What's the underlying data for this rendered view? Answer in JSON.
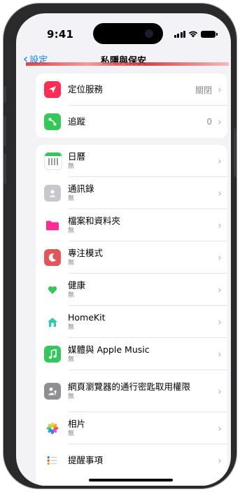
{
  "status": {
    "time": "9:41"
  },
  "nav": {
    "back_label": "設定",
    "title": "私隱與保安"
  },
  "group1": [
    {
      "label": "定位服務",
      "value": "關閉",
      "icon": "location-arrow-icon",
      "color": "#ff2d55"
    },
    {
      "label": "追蹤",
      "value": "0",
      "icon": "tracking-icon",
      "color": "#34c759"
    }
  ],
  "group2": [
    {
      "label": "日曆",
      "sub": "無",
      "icon": "calendar-icon",
      "color": "#ffffff"
    },
    {
      "label": "通訊錄",
      "sub": "無",
      "icon": "contacts-icon",
      "color": "#8e8e93"
    },
    {
      "label": "檔案和資料夾",
      "sub": "無",
      "icon": "folder-icon",
      "color": "#ff2d92"
    },
    {
      "label": "專注模式",
      "sub": "無",
      "icon": "moon-icon",
      "color": "#e0565b"
    },
    {
      "label": "健康",
      "sub": "無",
      "icon": "heart-icon",
      "color": "#ffffff"
    },
    {
      "label": "HomeKit",
      "sub": "無",
      "icon": "home-icon",
      "color": "#ffffff"
    },
    {
      "label": "媒體與 Apple Music",
      "sub": "無",
      "icon": "music-note-icon",
      "color": "#34c759"
    },
    {
      "label": "網頁瀏覽器的通行密匙取用權限",
      "sub": "無",
      "icon": "passkey-icon",
      "color": "#8e8e93"
    },
    {
      "label": "相片",
      "sub": "無",
      "icon": "photos-icon",
      "color": "#ffffff"
    },
    {
      "label": "提醒事項",
      "sub": "",
      "icon": "reminders-icon",
      "color": "#ffffff"
    }
  ]
}
